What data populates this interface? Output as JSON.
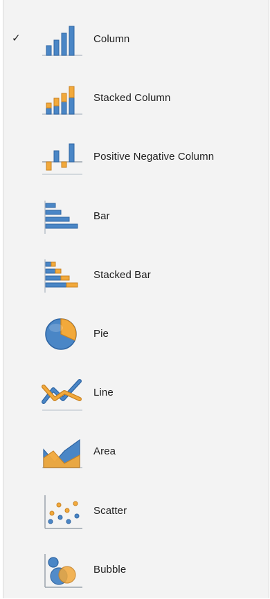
{
  "menu": {
    "selected_mark": "✓",
    "items": [
      {
        "label": "Column",
        "icon": "column-chart-icon",
        "selected": true
      },
      {
        "label": "Stacked Column",
        "icon": "stacked-column-chart-icon",
        "selected": false
      },
      {
        "label": "Positive Negative Column",
        "icon": "positive-negative-column-chart-icon",
        "selected": false
      },
      {
        "label": "Bar",
        "icon": "bar-chart-icon",
        "selected": false
      },
      {
        "label": "Stacked Bar",
        "icon": "stacked-bar-chart-icon",
        "selected": false
      },
      {
        "label": "Pie",
        "icon": "pie-chart-icon",
        "selected": false
      },
      {
        "label": "Line",
        "icon": "line-chart-icon",
        "selected": false
      },
      {
        "label": "Area",
        "icon": "area-chart-icon",
        "selected": false
      },
      {
        "label": "Scatter",
        "icon": "scatter-chart-icon",
        "selected": false
      },
      {
        "label": "Bubble",
        "icon": "bubble-chart-icon",
        "selected": false
      }
    ]
  },
  "colors": {
    "blue": "#4a86c6",
    "blue_dark": "#2f65a3",
    "orange": "#f2a93b",
    "orange_dark": "#c98221",
    "axis": "#9aa3ad"
  }
}
